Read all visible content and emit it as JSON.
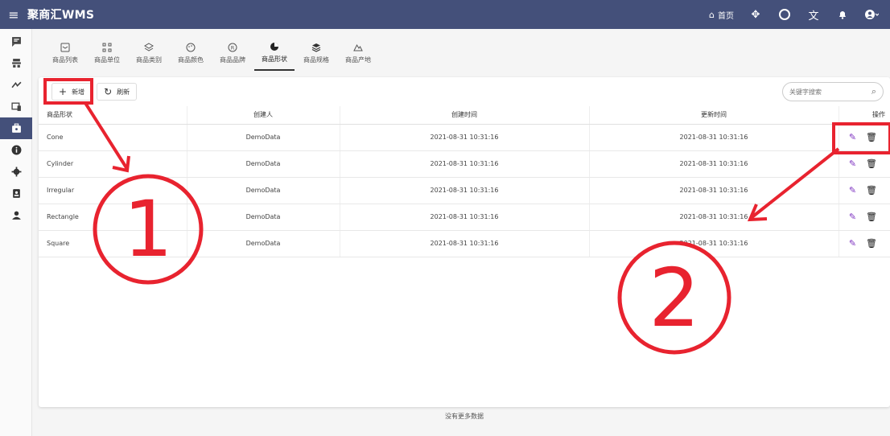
{
  "app": {
    "title": "聚商汇WMS"
  },
  "topbar": {
    "home_label": "首页"
  },
  "module_tabs": [
    {
      "label": "商品列表"
    },
    {
      "label": "商品单位"
    },
    {
      "label": "商品类别"
    },
    {
      "label": "商品颜色"
    },
    {
      "label": "商品品牌"
    },
    {
      "label": "商品形状"
    },
    {
      "label": "商品规格"
    },
    {
      "label": "商品产地"
    }
  ],
  "toolbar": {
    "add_label": "新增",
    "refresh_label": "刷新",
    "search_placeholder": "关键字搜索"
  },
  "table": {
    "headers": [
      "商品形状",
      "创建人",
      "创建时间",
      "更新时间",
      "操作"
    ],
    "rows": [
      [
        "Cone",
        "DemoData",
        "2021-08-31 10:31:16",
        "2021-08-31 10:31:16"
      ],
      [
        "Cylinder",
        "DemoData",
        "2021-08-31 10:31:16",
        "2021-08-31 10:31:16"
      ],
      [
        "Irregular",
        "DemoData",
        "2021-08-31 10:31:16",
        "2021-08-31 10:31:16"
      ],
      [
        "Rectangle",
        "DemoData",
        "2021-08-31 10:31:16",
        "2021-08-31 10:31:16"
      ],
      [
        "Square",
        "DemoData",
        "2021-08-31 10:31:16",
        "2021-08-31 10:31:16"
      ]
    ]
  },
  "footer": {
    "text": "没有更多数据"
  },
  "annotations": {
    "label_1": "①",
    "label_2": "②",
    "color": "#e8232f"
  },
  "colors": {
    "topbar": "#44507a",
    "edit": "#7b2fbf"
  }
}
